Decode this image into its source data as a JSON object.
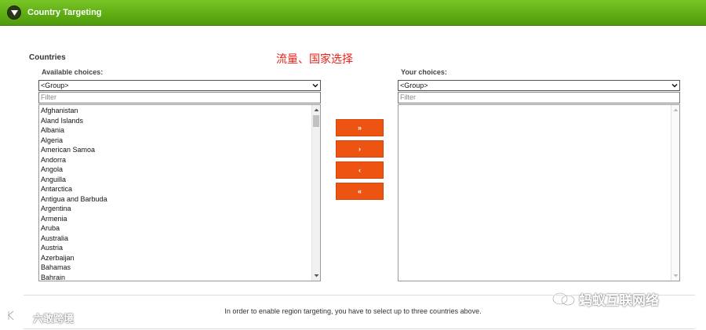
{
  "panel": {
    "title": "Country Targeting",
    "section_label": "Countries",
    "annotation": "流量、国家选择"
  },
  "available": {
    "label": "Available choices:",
    "group_select": "<Group>",
    "filter_placeholder": "Filter",
    "items": [
      "Afghanistan",
      "Aland Islands",
      "Albania",
      "Algeria",
      "American Samoa",
      "Andorra",
      "Angola",
      "Anguilla",
      "Antarctica",
      "Antigua and Barbuda",
      "Argentina",
      "Armenia",
      "Aruba",
      "Australia",
      "Austria",
      "Azerbaijan",
      "Bahamas",
      "Bahrain"
    ]
  },
  "chosen": {
    "label": "Your choices:",
    "group_select": "<Group>",
    "filter_placeholder": "Filter",
    "items": []
  },
  "move_buttons": {
    "add_all": "»",
    "add": "›",
    "remove": "‹",
    "remove_all": "«"
  },
  "info_text": "In order to enable region targeting, you have to select up to three countries above.",
  "watermarks": {
    "left": "六敢跨境",
    "right": "蚂蚁互联网络"
  },
  "colors": {
    "header_green": "#5fae14",
    "button_orange": "#ee5411",
    "annotation_red": "#e3231b"
  }
}
